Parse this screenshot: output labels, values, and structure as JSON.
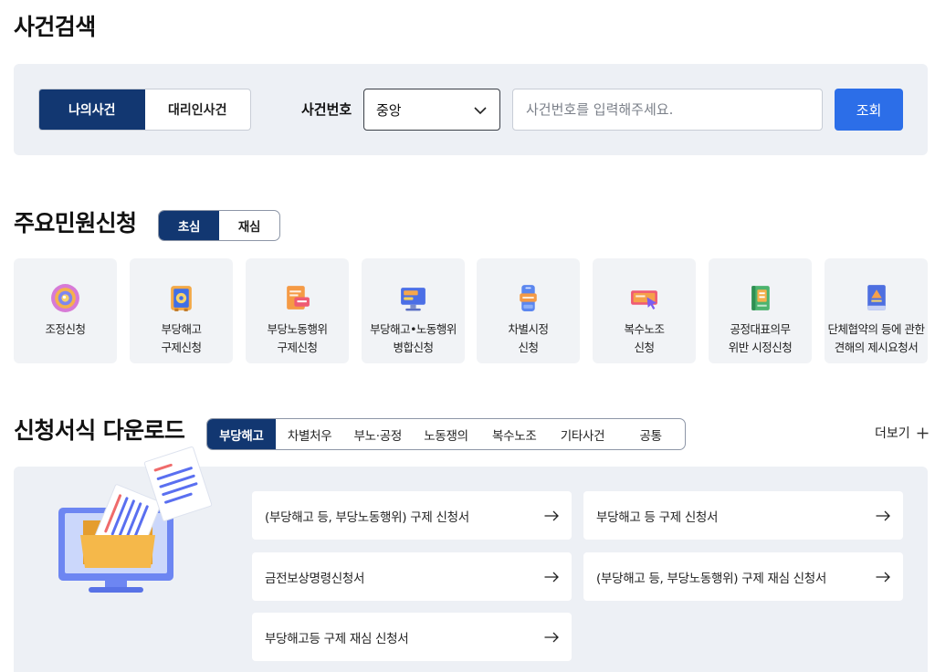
{
  "page_title": "사건검색",
  "case_search": {
    "tabs": [
      {
        "label": "나의사건",
        "active": true
      },
      {
        "label": "대리인사건",
        "active": false
      }
    ],
    "case_number_label": "사건번호",
    "court_select": {
      "value": "중앙",
      "icon": "chevron-down-icon"
    },
    "case_number_input": {
      "placeholder": "사건번호를 입력해주세요."
    },
    "search_button": "조회"
  },
  "petitions": {
    "title": "주요민원신청",
    "tabs": [
      {
        "label": "초심",
        "active": true
      },
      {
        "label": "재심",
        "active": false
      }
    ],
    "items": [
      {
        "lines": [
          "조정신청"
        ],
        "icon": "mediation-target-icon"
      },
      {
        "lines": [
          "부당해고",
          "구제신청"
        ],
        "icon": "safe-box-icon"
      },
      {
        "lines": [
          "부당노동행위",
          "구제신청"
        ],
        "icon": "document-badge-icon"
      },
      {
        "lines": [
          "부당해고•노동행위",
          "병합신청"
        ],
        "icon": "monitor-icon"
      },
      {
        "lines": [
          "차별시정",
          "신청"
        ],
        "icon": "phone-icon"
      },
      {
        "lines": [
          "복수노조",
          "신청"
        ],
        "icon": "screen-cursor-icon"
      },
      {
        "lines": [
          "공정대표의무",
          "위반 시정신청"
        ],
        "icon": "green-book-icon"
      },
      {
        "lines": [
          "단체협약의 등에 관한",
          "견해의 제시요청서"
        ],
        "icon": "blue-book-icon"
      }
    ]
  },
  "forms": {
    "title": "신청서식 다운로드",
    "tabs": [
      {
        "label": "부당해고",
        "active": true
      },
      {
        "label": "차별처우",
        "active": false
      },
      {
        "label": "부노·공정",
        "active": false
      },
      {
        "label": "노동쟁의",
        "active": false
      },
      {
        "label": "복수노조",
        "active": false
      },
      {
        "label": "기타사건",
        "active": false
      },
      {
        "label": "공통",
        "active": false
      }
    ],
    "more": {
      "label": "더보기",
      "icon": "plus-icon"
    },
    "items": [
      {
        "label": "(부당해고 등, 부당노동행위) 구제 신청서",
        "icon": "arrow-right-icon"
      },
      {
        "label": "부당해고 등 구제 신청서",
        "icon": "arrow-right-icon"
      },
      {
        "label": "금전보상명령신청서",
        "icon": "arrow-right-icon"
      },
      {
        "label": "(부당해고 등, 부당노동행위) 구제 재심 신청서",
        "icon": "arrow-right-icon"
      },
      {
        "label": "부당해고등 구제 재심 신청서",
        "icon": "arrow-right-icon"
      }
    ]
  },
  "colors": {
    "primary_navy": "#123771",
    "accent_blue": "#2c6ee8",
    "panel_bg": "#edf0f5",
    "card_bg": "#f1f3f6"
  }
}
